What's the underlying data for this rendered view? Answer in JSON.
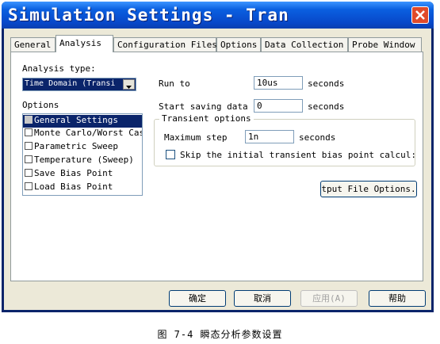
{
  "window": {
    "title": "Simulation Settings - Tran"
  },
  "tabs": [
    {
      "label": "General"
    },
    {
      "label": "Analysis"
    },
    {
      "label": "Configuration Files"
    },
    {
      "label": "Options"
    },
    {
      "label": "Data Collection"
    },
    {
      "label": "Probe Window"
    }
  ],
  "active_tab": "Analysis",
  "analysis_type": {
    "label": "Analysis type:",
    "value": "Time Domain (Transi"
  },
  "options": {
    "label": "Options",
    "items": [
      {
        "label": "General Settings",
        "checked": true,
        "selected": true
      },
      {
        "label": "Monte Carlo/Worst Cas",
        "checked": false
      },
      {
        "label": "Parametric Sweep",
        "checked": false
      },
      {
        "label": "Temperature (Sweep)",
        "checked": false
      },
      {
        "label": "Save Bias Point",
        "checked": false
      },
      {
        "label": "Load Bias Point",
        "checked": false
      }
    ]
  },
  "run_to": {
    "label": "Run to",
    "value": "10us",
    "unit": "seconds"
  },
  "start_saving": {
    "label": "Start saving data",
    "value": "0",
    "unit": "seconds"
  },
  "transient": {
    "group_label": "Transient options",
    "max_step_label": "Maximum step",
    "max_step_value": "1n",
    "max_step_unit": "seconds",
    "skip_label": "Skip the initial transient bias point calcul:"
  },
  "output_file_button": "tput File Options.",
  "footer": {
    "ok": "确定",
    "cancel": "取消",
    "apply": "应用(A)",
    "help": "帮助"
  },
  "caption": "图 7-4 瞬态分析参数设置"
}
